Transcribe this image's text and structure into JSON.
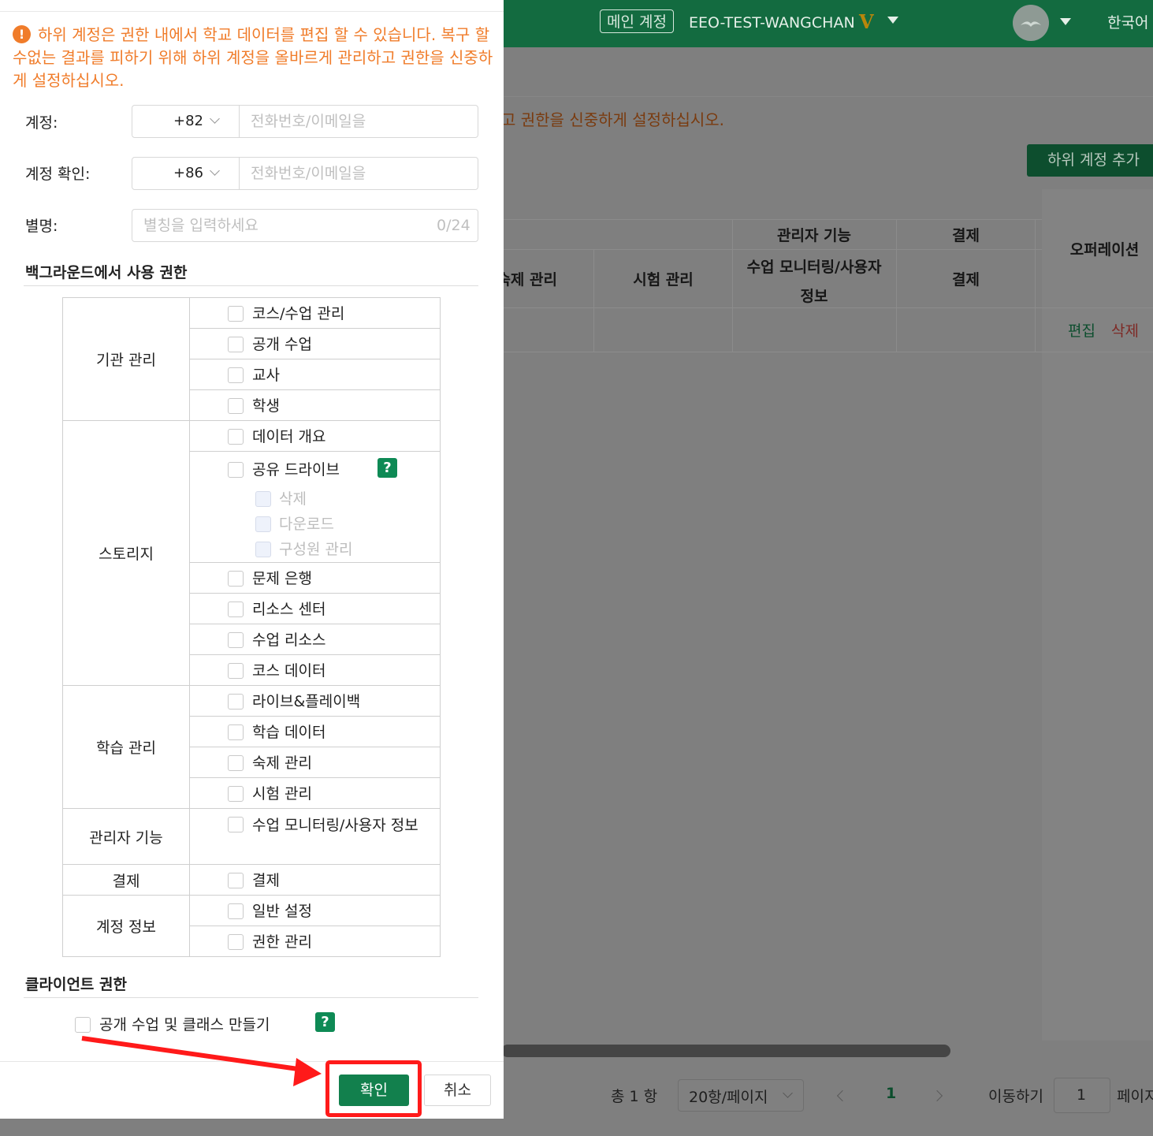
{
  "header": {
    "main_account_badge": "메인 계정",
    "org_name": "EEO-TEST-WANGCHAN",
    "vip_badge": "V",
    "language": "한국어"
  },
  "background": {
    "warning_tail": "고 권한을 신중하게 설정하십시오.",
    "add_sub_account_button": "하위 계정 추가",
    "table": {
      "group_headers": [
        "관리자 기능",
        "결제"
      ],
      "sub_headers": [
        "숙제 관리",
        "시험 관리",
        "수업 모니터링/사용자 정보",
        "결제"
      ],
      "operations_header": "오퍼레이션",
      "row_actions": [
        "편집",
        "삭제"
      ]
    },
    "pager": {
      "total": "총 1 항",
      "page_size": "20항/페이지",
      "current_page": "1",
      "goto_label": "이동하기",
      "goto_value": "1",
      "page_suffix": "페이지"
    }
  },
  "modal": {
    "warning": "하위 계정은 권한 내에서 학교 데이터를 편집 할 수 있습니다. 복구 할 수없는 결과를 피하기 위해 하위 계정을 올바르게 관리하고 권한을 신중하게 설정하십시오.",
    "warning_icon": "!",
    "fields": {
      "account": {
        "label": "계정:",
        "country_code": "+82",
        "placeholder": "전화번호/이메일을"
      },
      "account_confirm": {
        "label": "계정 확인:",
        "country_code": "+86",
        "placeholder": "전화번호/이메일을"
      },
      "alias": {
        "label": "별명:",
        "placeholder": "별칭을 입력하세요",
        "counter": "0/24"
      }
    },
    "backend_section_title": "백그라운드에서 사용 권한",
    "permission_groups": [
      {
        "name": "기관 관리",
        "options": [
          "코스/수업 관리",
          "공개 수업",
          "교사",
          "학생"
        ]
      },
      {
        "name": "스토리지",
        "options": [
          "데이터 개요",
          "공유 드라이브",
          "문제 은행",
          "리소스 센터",
          "수업 리소스",
          "코스 데이터"
        ],
        "shared_drive_suboptions": [
          "삭제",
          "다운로드",
          "구성원 관리"
        ]
      },
      {
        "name": "학습 관리",
        "options": [
          "라이브&플레이백",
          "학습 데이터",
          "숙제 관리",
          "시험 관리"
        ]
      },
      {
        "name": "관리자 기능",
        "options": [
          "수업 모니터링/사용자 정보"
        ]
      },
      {
        "name": "결제",
        "options": [
          "결제"
        ]
      },
      {
        "name": "계정 정보",
        "options": [
          "일반 설정",
          "권한 관리"
        ]
      }
    ],
    "help_icon_label": "?",
    "client_section_title": "클라이언트 권한",
    "client_option": "공개 수업 및 클래스 만들기",
    "confirm_button": "확인",
    "cancel_button": "취소"
  },
  "colors": {
    "brand_green": "#136b40",
    "button_green": "#12804d",
    "warning_orange": "#f07c2a",
    "highlight_red": "#ff1a1a"
  }
}
